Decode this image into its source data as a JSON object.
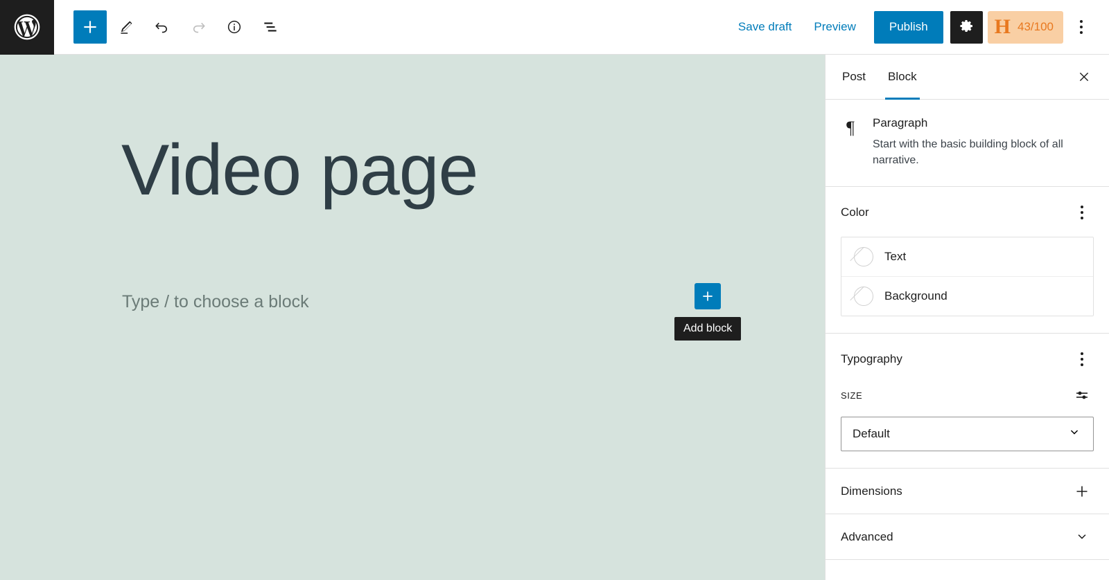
{
  "app": {
    "logo_icon": "wordpress-logo-icon"
  },
  "toolbar": {
    "add_block_label": "+",
    "tools": [
      {
        "name": "block-inserter-toggle",
        "icon": "plus-icon"
      },
      {
        "name": "tools-edit-mode",
        "icon": "pencil-icon"
      },
      {
        "name": "undo",
        "icon": "undo-arrow-icon"
      },
      {
        "name": "redo",
        "icon": "redo-arrow-icon"
      },
      {
        "name": "details",
        "icon": "info-circle-icon"
      },
      {
        "name": "list-view",
        "icon": "list-view-icon"
      }
    ],
    "save_draft_label": "Save draft",
    "preview_label": "Preview",
    "publish_label": "Publish",
    "settings_icon": "gear-icon",
    "score": {
      "letter": "H",
      "value": "43/100"
    },
    "options_icon": "vertical-ellipsis-icon"
  },
  "canvas": {
    "background_color": "#d6e3dd",
    "post_title": "Video page",
    "paragraph_placeholder": "Type / to choose a block",
    "appender": {
      "icon": "plus-icon",
      "tooltip": "Add block"
    }
  },
  "sidebar": {
    "tabs": [
      {
        "label": "Post",
        "active": false
      },
      {
        "label": "Block",
        "active": true
      }
    ],
    "close_icon": "close-x-icon",
    "block_card": {
      "icon": "pilcrow-icon",
      "glyph": "¶",
      "name": "Paragraph",
      "description": "Start with the basic building block of all narrative."
    },
    "color_panel": {
      "title": "Color",
      "menu_icon": "vertical-ellipsis-icon",
      "rows": [
        {
          "label": "Text",
          "swatch": "none"
        },
        {
          "label": "Background",
          "swatch": "none"
        }
      ]
    },
    "typography_panel": {
      "title": "Typography",
      "menu_icon": "vertical-ellipsis-icon",
      "size_label": "SIZE",
      "size_tools_icon": "sliders-icon",
      "size_value": "Default",
      "size_chevron_icon": "chevron-down-icon"
    },
    "dimensions_panel": {
      "title": "Dimensions",
      "icon": "plus-icon"
    },
    "advanced_panel": {
      "title": "Advanced",
      "icon": "chevron-down-icon"
    }
  },
  "colors": {
    "accent": "#007cba",
    "dark": "#1e1e1e",
    "canvas_bg": "#d6e3dd",
    "badge_bg": "#f9cfa4",
    "badge_fg": "#e8781f"
  }
}
